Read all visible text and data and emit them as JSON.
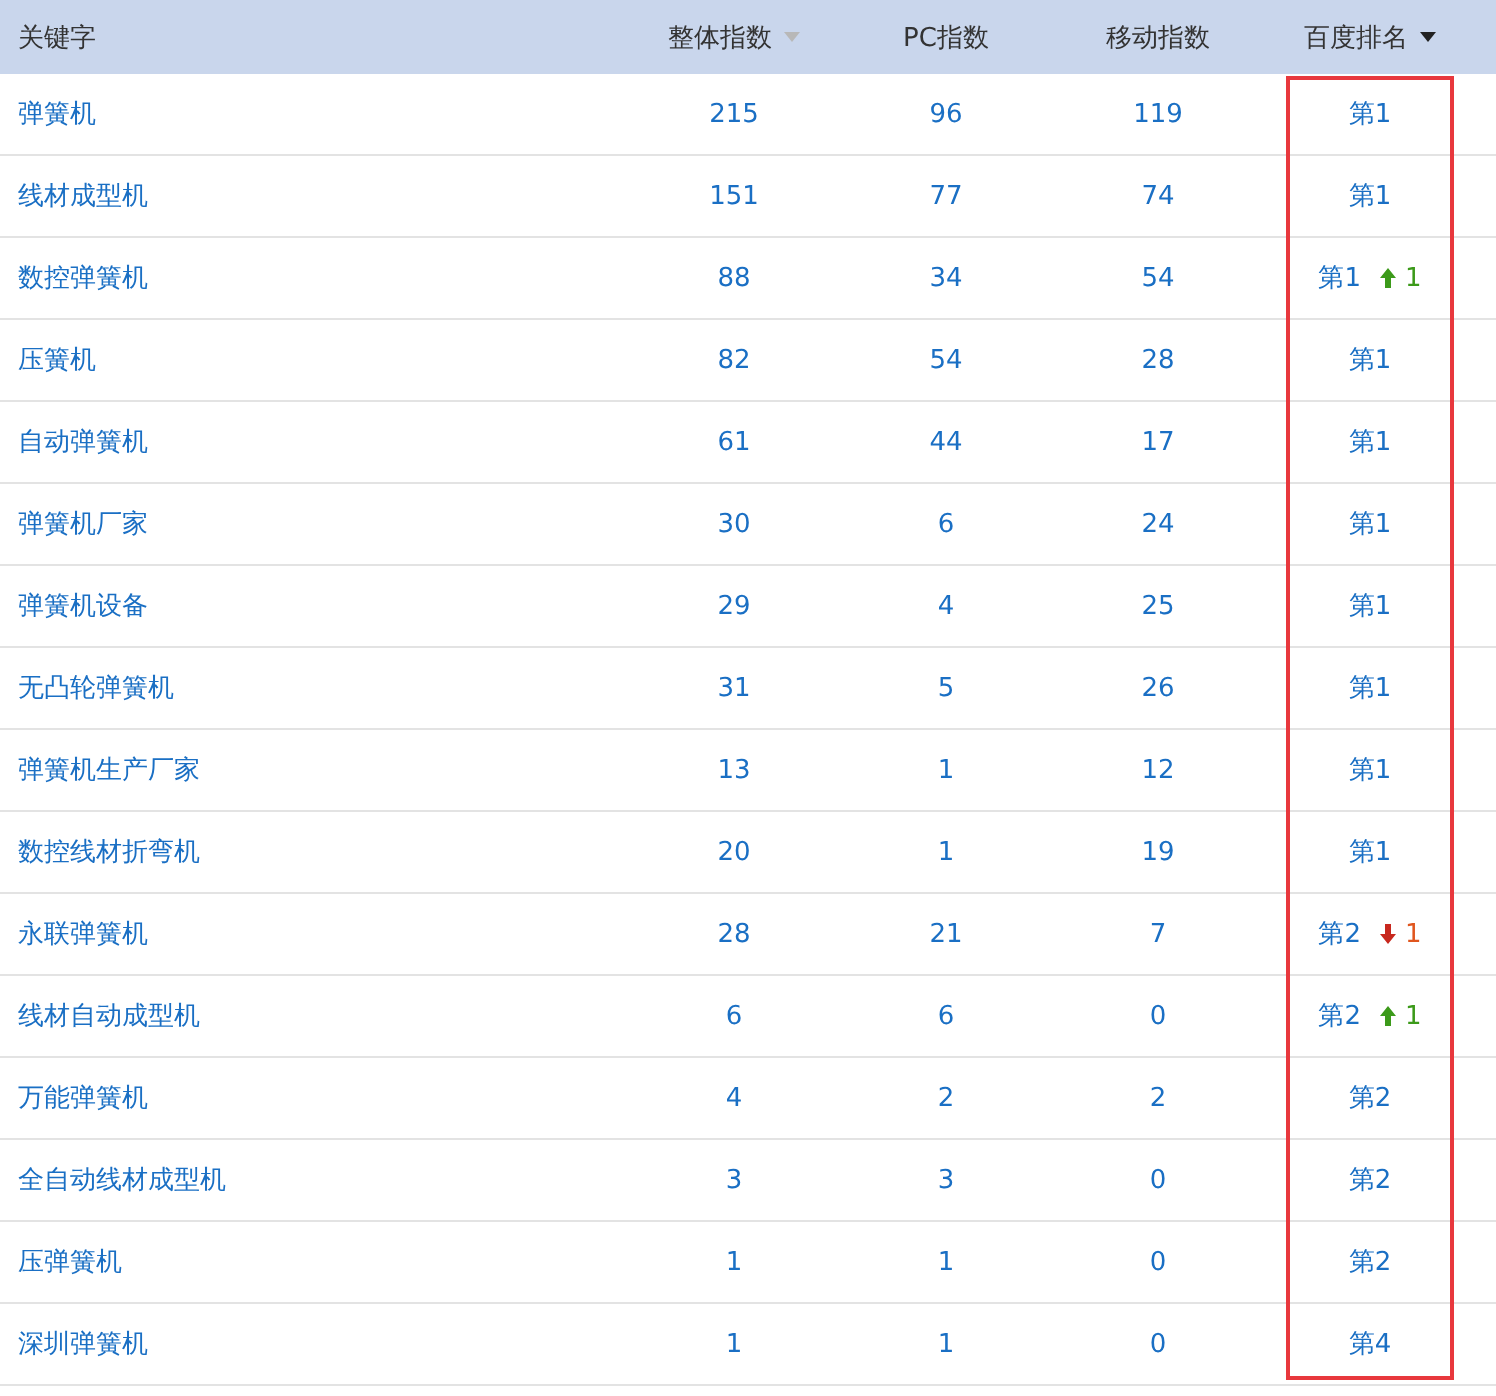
{
  "columns": [
    {
      "label": "关键字",
      "sortable": false,
      "sorted": false,
      "highlighted": false
    },
    {
      "label": "整体指数",
      "sortable": true,
      "sorted": false,
      "highlighted": false
    },
    {
      "label": "PC指数",
      "sortable": false,
      "sorted": false,
      "highlighted": false
    },
    {
      "label": "移动指数",
      "sortable": false,
      "sorted": false,
      "highlighted": false
    },
    {
      "label": "百度排名",
      "sortable": true,
      "sorted": true,
      "highlighted": true
    }
  ],
  "rows": [
    {
      "keyword": "弹簧机",
      "overall": "215",
      "pc": "96",
      "mobile": "119",
      "rank": "第1"
    },
    {
      "keyword": "线材成型机",
      "overall": "151",
      "pc": "77",
      "mobile": "74",
      "rank": "第1"
    },
    {
      "keyword": "数控弹簧机",
      "overall": "88",
      "pc": "34",
      "mobile": "54",
      "rank": "第1",
      "change": {
        "up": true,
        "amount": "1"
      }
    },
    {
      "keyword": "压簧机",
      "overall": "82",
      "pc": "54",
      "mobile": "28",
      "rank": "第1"
    },
    {
      "keyword": "自动弹簧机",
      "overall": "61",
      "pc": "44",
      "mobile": "17",
      "rank": "第1"
    },
    {
      "keyword": "弹簧机厂家",
      "overall": "30",
      "pc": "6",
      "mobile": "24",
      "rank": "第1"
    },
    {
      "keyword": "弹簧机设备",
      "overall": "29",
      "pc": "4",
      "mobile": "25",
      "rank": "第1"
    },
    {
      "keyword": "无凸轮弹簧机",
      "overall": "31",
      "pc": "5",
      "mobile": "26",
      "rank": "第1"
    },
    {
      "keyword": "弹簧机生产厂家",
      "overall": "13",
      "pc": "1",
      "mobile": "12",
      "rank": "第1"
    },
    {
      "keyword": "数控线材折弯机",
      "overall": "20",
      "pc": "1",
      "mobile": "19",
      "rank": "第1"
    },
    {
      "keyword": "永联弹簧机",
      "overall": "28",
      "pc": "21",
      "mobile": "7",
      "rank": "第2",
      "change": {
        "up": false,
        "amount": "1"
      }
    },
    {
      "keyword": "线材自动成型机",
      "overall": "6",
      "pc": "6",
      "mobile": "0",
      "rank": "第2",
      "change": {
        "up": true,
        "amount": "1"
      }
    },
    {
      "keyword": "万能弹簧机",
      "overall": "4",
      "pc": "2",
      "mobile": "2",
      "rank": "第2"
    },
    {
      "keyword": "全自动线材成型机",
      "overall": "3",
      "pc": "3",
      "mobile": "0",
      "rank": "第2"
    },
    {
      "keyword": "压弹簧机",
      "overall": "1",
      "pc": "1",
      "mobile": "0",
      "rank": "第2"
    },
    {
      "keyword": "深圳弹簧机",
      "overall": "1",
      "pc": "1",
      "mobile": "0",
      "rank": "第4"
    }
  ]
}
